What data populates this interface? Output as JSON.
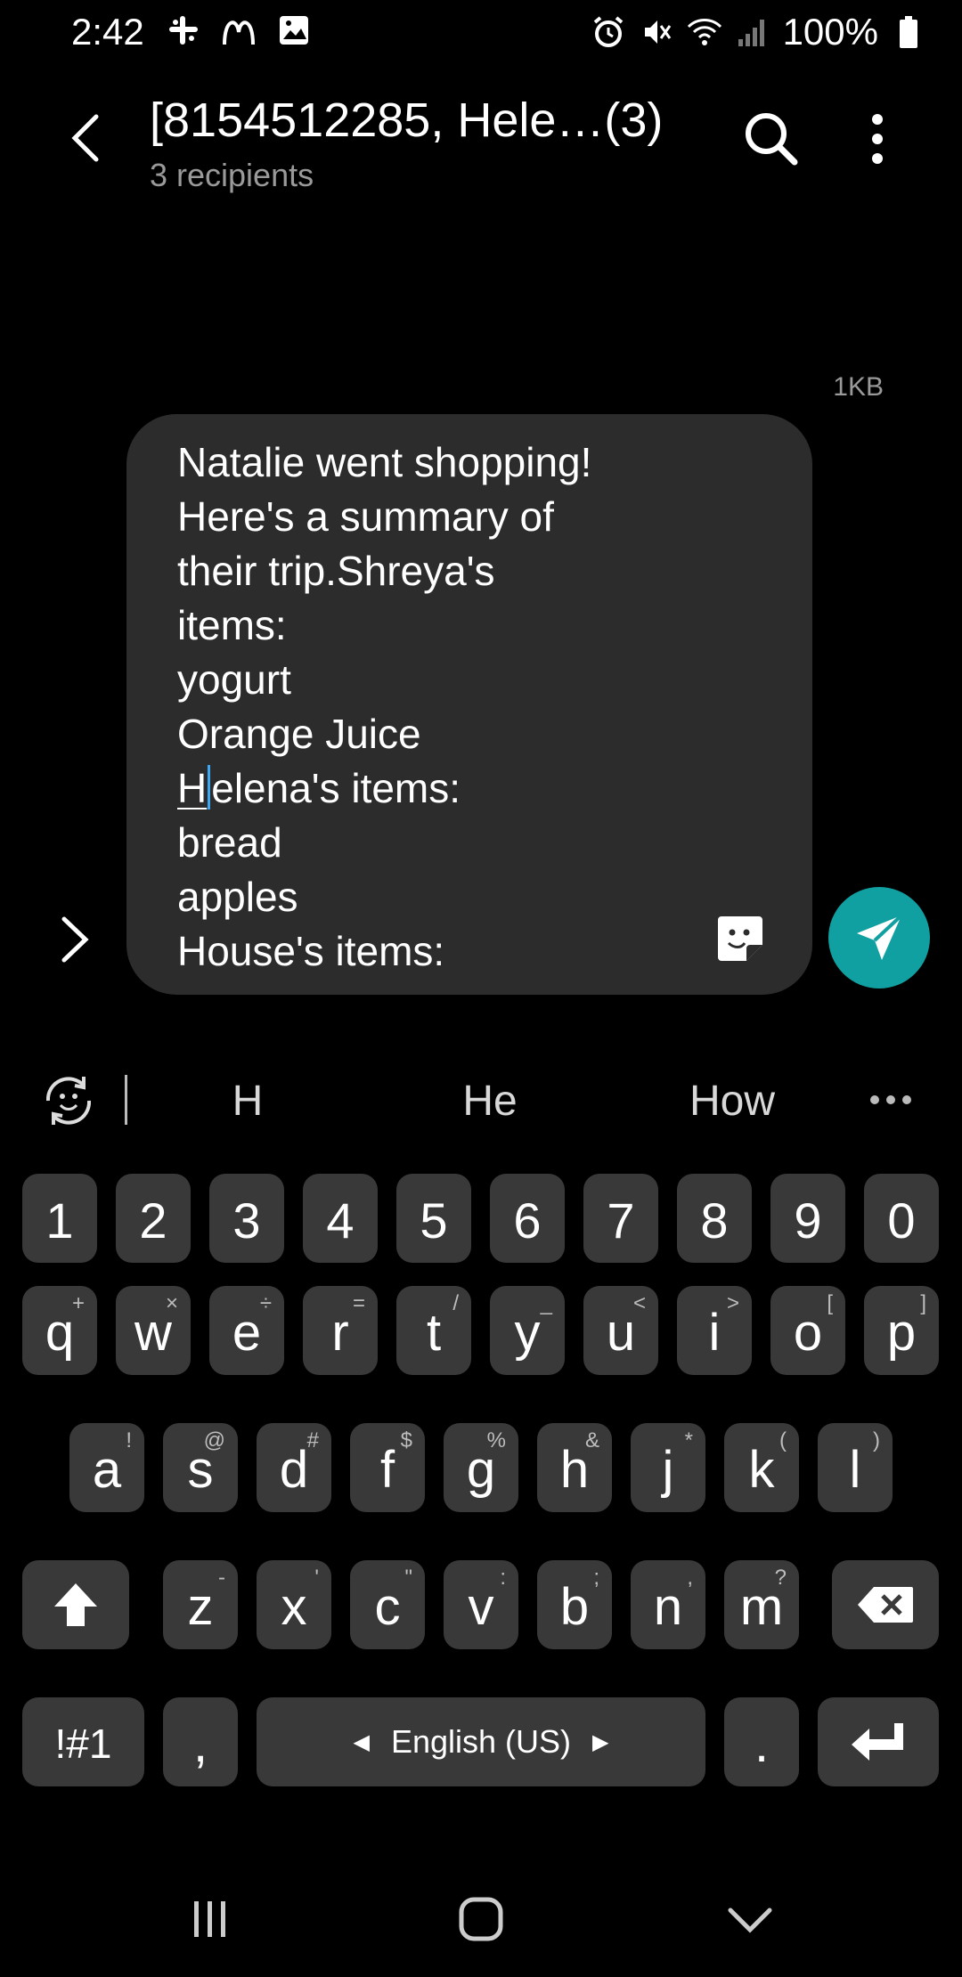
{
  "status_bar": {
    "time": "2:42",
    "battery": "100%",
    "left_icons": [
      "slack-icon",
      "mcdonalds-icon",
      "gallery-icon"
    ],
    "right_icons": [
      "alarm-icon",
      "mute-icon",
      "wifi-icon",
      "signal-icon",
      "battery-icon"
    ]
  },
  "header": {
    "title": "[8154512285, Hele…(3)",
    "subtitle": "3 recipients"
  },
  "message": {
    "size_label": "1KB",
    "lines_before": [
      "Natalie went shopping!",
      "Here's a summary of",
      "their trip.Shreya's",
      "items:",
      "yogurt",
      "Orange Juice"
    ],
    "cursor_line": {
      "underlined": "H",
      "after_caret": "elena's items:"
    },
    "lines_after": [
      "bread",
      "apples",
      "House's items:"
    ]
  },
  "suggestions": [
    "H",
    "He",
    "How"
  ],
  "keyboard": {
    "numbers": [
      "1",
      "2",
      "3",
      "4",
      "5",
      "6",
      "7",
      "8",
      "9",
      "0"
    ],
    "row1": [
      {
        "k": "q",
        "h": "+"
      },
      {
        "k": "w",
        "h": "×"
      },
      {
        "k": "e",
        "h": "÷"
      },
      {
        "k": "r",
        "h": "="
      },
      {
        "k": "t",
        "h": "/"
      },
      {
        "k": "y",
        "h": "_"
      },
      {
        "k": "u",
        "h": "<"
      },
      {
        "k": "i",
        "h": ">"
      },
      {
        "k": "o",
        "h": "["
      },
      {
        "k": "p",
        "h": "]"
      }
    ],
    "row2": [
      {
        "k": "a",
        "h": "!"
      },
      {
        "k": "s",
        "h": "@"
      },
      {
        "k": "d",
        "h": "#"
      },
      {
        "k": "f",
        "h": "$"
      },
      {
        "k": "g",
        "h": "%"
      },
      {
        "k": "h",
        "h": "&"
      },
      {
        "k": "j",
        "h": "*"
      },
      {
        "k": "k",
        "h": "("
      },
      {
        "k": "l",
        "h": ")"
      }
    ],
    "row3": [
      {
        "k": "z",
        "h": "-"
      },
      {
        "k": "x",
        "h": "'"
      },
      {
        "k": "c",
        "h": "\""
      },
      {
        "k": "v",
        "h": ":"
      },
      {
        "k": "b",
        "h": ";"
      },
      {
        "k": "n",
        "h": ","
      },
      {
        "k": "m",
        "h": "?"
      }
    ],
    "symbols_label": "!#1",
    "comma_label": ",",
    "space_label": "English (US)",
    "period_label": "."
  },
  "colors": {
    "send_button": "#11a0a1",
    "caret": "#3da9f5",
    "bubble": "#2c2c2c",
    "key": "#393939"
  }
}
